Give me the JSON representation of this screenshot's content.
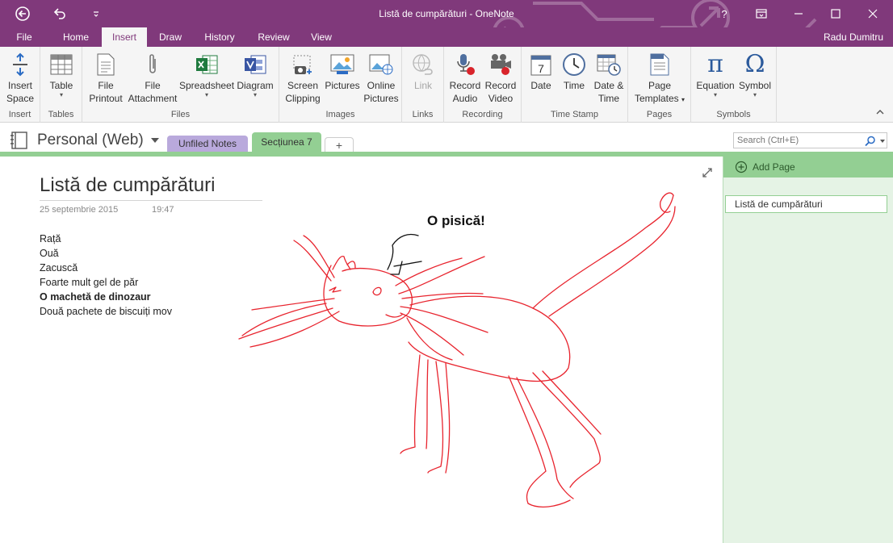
{
  "window": {
    "title": "Listă de cumpărături - OneNote",
    "help": "?"
  },
  "menu": {
    "tabs": [
      "File",
      "Home",
      "Insert",
      "Draw",
      "History",
      "Review",
      "View"
    ],
    "active": "Insert",
    "user": "Radu Dumitru"
  },
  "ribbon": {
    "groups": {
      "insert": "Insert",
      "tables": "Tables",
      "files": "Files",
      "images": "Images",
      "links": "Links",
      "recording": "Recording",
      "time_stamp": "Time Stamp",
      "pages": "Pages",
      "symbols": "Symbols"
    },
    "buttons": {
      "insert_space": [
        "Insert",
        "Space"
      ],
      "table": [
        "Table"
      ],
      "file_printout": [
        "File",
        "Printout"
      ],
      "file_attachment": [
        "File",
        "Attachment"
      ],
      "spreadsheet": [
        "Spreadsheet"
      ],
      "diagram": [
        "Diagram"
      ],
      "screen_clipping": [
        "Screen",
        "Clipping"
      ],
      "pictures": [
        "Pictures"
      ],
      "online_pictures": [
        "Online",
        "Pictures"
      ],
      "link": [
        "Link"
      ],
      "record_audio": [
        "Record",
        "Audio"
      ],
      "record_video": [
        "Record",
        "Video"
      ],
      "date": [
        "Date"
      ],
      "time": [
        "Time"
      ],
      "date_time": [
        "Date &",
        "Time"
      ],
      "page_templates": [
        "Page",
        "Templates"
      ],
      "equation": [
        "Equation"
      ],
      "symbol": [
        "Symbol"
      ]
    },
    "date_icon_number": "7"
  },
  "notebook": {
    "name": "Personal (Web)",
    "sections": [
      "Unfiled Notes",
      "Secțiunea 7"
    ],
    "add_section": "+",
    "search_placeholder": "Search (Ctrl+E)"
  },
  "page": {
    "title": "Listă de cumpărături",
    "date": "25 septembrie 2015",
    "time": "19:47",
    "items": [
      {
        "text": "Rață",
        "bold": false
      },
      {
        "text": "Ouă",
        "bold": false
      },
      {
        "text": "Zacuscă",
        "bold": false
      },
      {
        "text": "Foarte mult gel de păr",
        "bold": false
      },
      {
        "text": "O machetă de dinozaur",
        "bold": true
      },
      {
        "text": "Două pachete de biscuiți mov",
        "bold": false
      }
    ],
    "ink_text": "O pisică!"
  },
  "pages_pane": {
    "add_page": "Add Page",
    "pages": [
      "Listă de cumpărături"
    ]
  },
  "colors": {
    "brand": "#80397b",
    "section_green": "#93cf93",
    "section_purple": "#b9a9dc",
    "ink_red": "#e8242e"
  }
}
